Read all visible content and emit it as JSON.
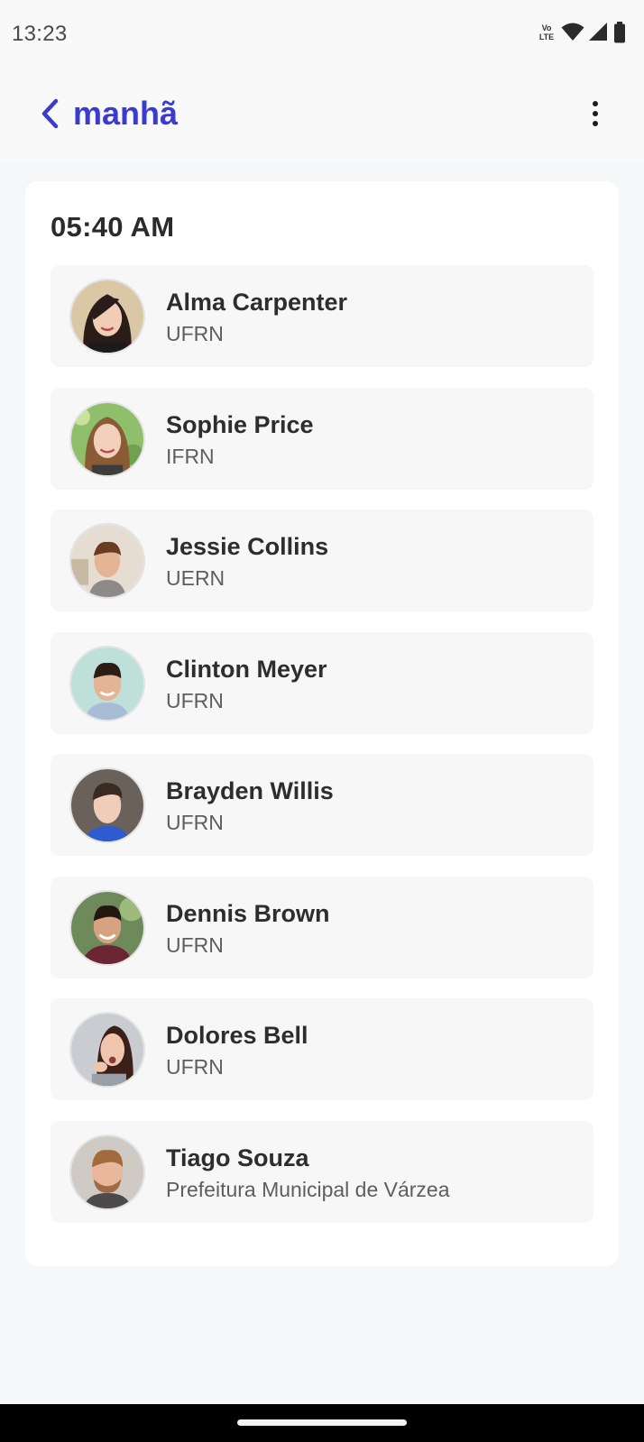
{
  "status_bar": {
    "time": "13:23",
    "volte_line1": "Vo",
    "volte_line2": "LTE",
    "icons": [
      "volte-icon",
      "wifi-icon",
      "signal-icon",
      "battery-icon"
    ]
  },
  "header": {
    "title": "manhã",
    "back_icon": "chevron-left-icon",
    "menu_icon": "more-vertical-icon"
  },
  "colors": {
    "accent": "#3a3bcf",
    "background": "#f6f7f9",
    "card": "#ffffff",
    "item": "#f7f7f8"
  },
  "schedule": {
    "time": "05:40 AM",
    "people": [
      {
        "name": "Alma Carpenter",
        "org": "UFRN"
      },
      {
        "name": "Sophie Price",
        "org": "IFRN"
      },
      {
        "name": "Jessie Collins",
        "org": "UERN"
      },
      {
        "name": "Clinton Meyer",
        "org": "UFRN"
      },
      {
        "name": "Brayden Willis",
        "org": "UFRN"
      },
      {
        "name": "Dennis Brown",
        "org": "UFRN"
      },
      {
        "name": "Dolores Bell",
        "org": "UFRN"
      },
      {
        "name": "Tiago Souza",
        "org": "Prefeitura Municipal de Várzea"
      }
    ]
  }
}
